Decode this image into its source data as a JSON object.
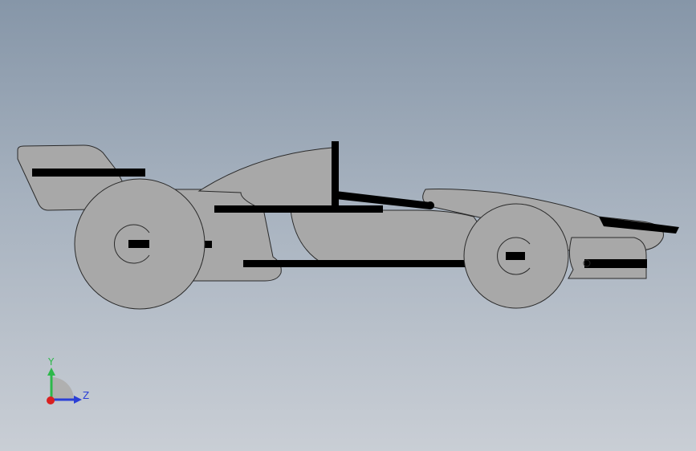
{
  "viewport": {
    "background_top": "#8696a8",
    "background_bottom": "#c9ced5"
  },
  "model": {
    "body_fill": "#a8a8a8",
    "outline": "#2a2a2a",
    "edge": "#000000"
  },
  "triad": {
    "y_label": "Y",
    "z_label": "Z",
    "y_color": "#2db84a",
    "z_color": "#2b3fd6",
    "x_color": "#d92020",
    "icon": "coordinate-triad-icon"
  }
}
